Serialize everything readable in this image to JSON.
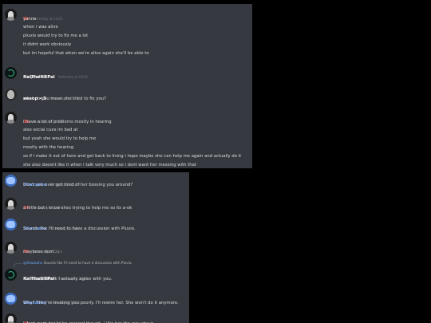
{
  "colors": {
    "background": "#000000",
    "panel": "#36393f",
    "username_red": "#e0463e",
    "username_white": "#ffffff",
    "username_blue": "#5b8fe6",
    "timestamp": "#72767d",
    "text": "#dcddde"
  },
  "panel_top": {
    "messages": [
      {
        "username": "Sh",
        "name_color": "#e0463e",
        "avatar": "dark-avatar",
        "timestamp": "Yesterday at 23:01",
        "lines": [
          "yanno",
          "when i was alive",
          "pluvio would try to fix me a lot",
          "it didnt work obviously",
          "but im hopeful that when we're alive again she'll be able to"
        ]
      },
      {
        "username": "KaITheNBPal",
        "name_color": "#ffffff",
        "avatar": "kal-avatar",
        "timestamp": "Yesterday at 23:01",
        "lines": [
          "Fix you?"
        ]
      },
      {
        "username": "aesop <3",
        "name_color": "#ffffff",
        "avatar": "aesop-avatar",
        "timestamp": "Yesterday at 23:02",
        "lines": [
          "what do you mean she tried to fix you?"
        ]
      },
      {
        "username": "Sh",
        "name_color": "#e0463e",
        "avatar": "dark-avatar",
        "timestamp": "Yesterday at 23:02",
        "lines": [
          "i have a lot of problems mostly in hearing",
          "also social cues im bad at",
          "but yeah she would try to help me",
          "mostly with the hearing",
          "so if i make it out of here and get back to living i hope maybe she can help me again and actually do it",
          "she also doesnt like it when i talk very much so i dont want her messing with that"
        ]
      }
    ]
  },
  "panel_bottom": {
    "messages": [
      {
        "username": "Shazzaho",
        "name_color": "#5b8fe6",
        "avatar": "blue-avatar",
        "timestamp": "Yesterday at 23:03",
        "lines": [
          "Don't you ever get tired of her bossing you around?"
        ]
      },
      {
        "username": "Sh",
        "name_color": "#e0463e",
        "avatar": "dark-avatar",
        "timestamp": "Yesterday at 23:03",
        "lines": [
          "a little but i know shes trying to help me so its a-ok"
        ]
      },
      {
        "username": "Shazzaho",
        "name_color": "#5b8fe6",
        "avatar": "blue-avatar",
        "timestamp": "Yesterday at 23:04",
        "lines": [
          "Sounds like I'll need to have a discussion with Pluvio."
        ]
      },
      {
        "username": "Sh",
        "name_color": "#e0463e",
        "avatar": "dark-avatar",
        "timestamp": "Yesterday at 23:04",
        "lines": [
          "maybeee dont ;-;"
        ]
      },
      {
        "reply_to": {
          "username": "@Shazzaho",
          "text": "Sounds like I'll need to have a discussion with Pluvio."
        },
        "username": "KaITheNBPal",
        "name_color": "#ffffff",
        "avatar": "kal-avatar",
        "timestamp": "Yesterday at 23:04",
        "lines": [
          "For once, I think I actually agree with you."
        ]
      },
      {
        "username": "Shazzaho",
        "name_color": "#5b8fe6",
        "avatar": "blue-avatar",
        "timestamp": "Yesterday at 23:04",
        "lines": [
          "Why? They're treating you poorly. I'll rewire her. She won't do it anymore."
        ]
      },
      {
        "username": "Sh",
        "name_color": "#e0463e",
        "avatar": "dark-avatar",
        "timestamp": "Yesterday at 23:07",
        "lines": [
          "i dont want her to be rewired though, i like her the way she is"
        ]
      }
    ]
  }
}
